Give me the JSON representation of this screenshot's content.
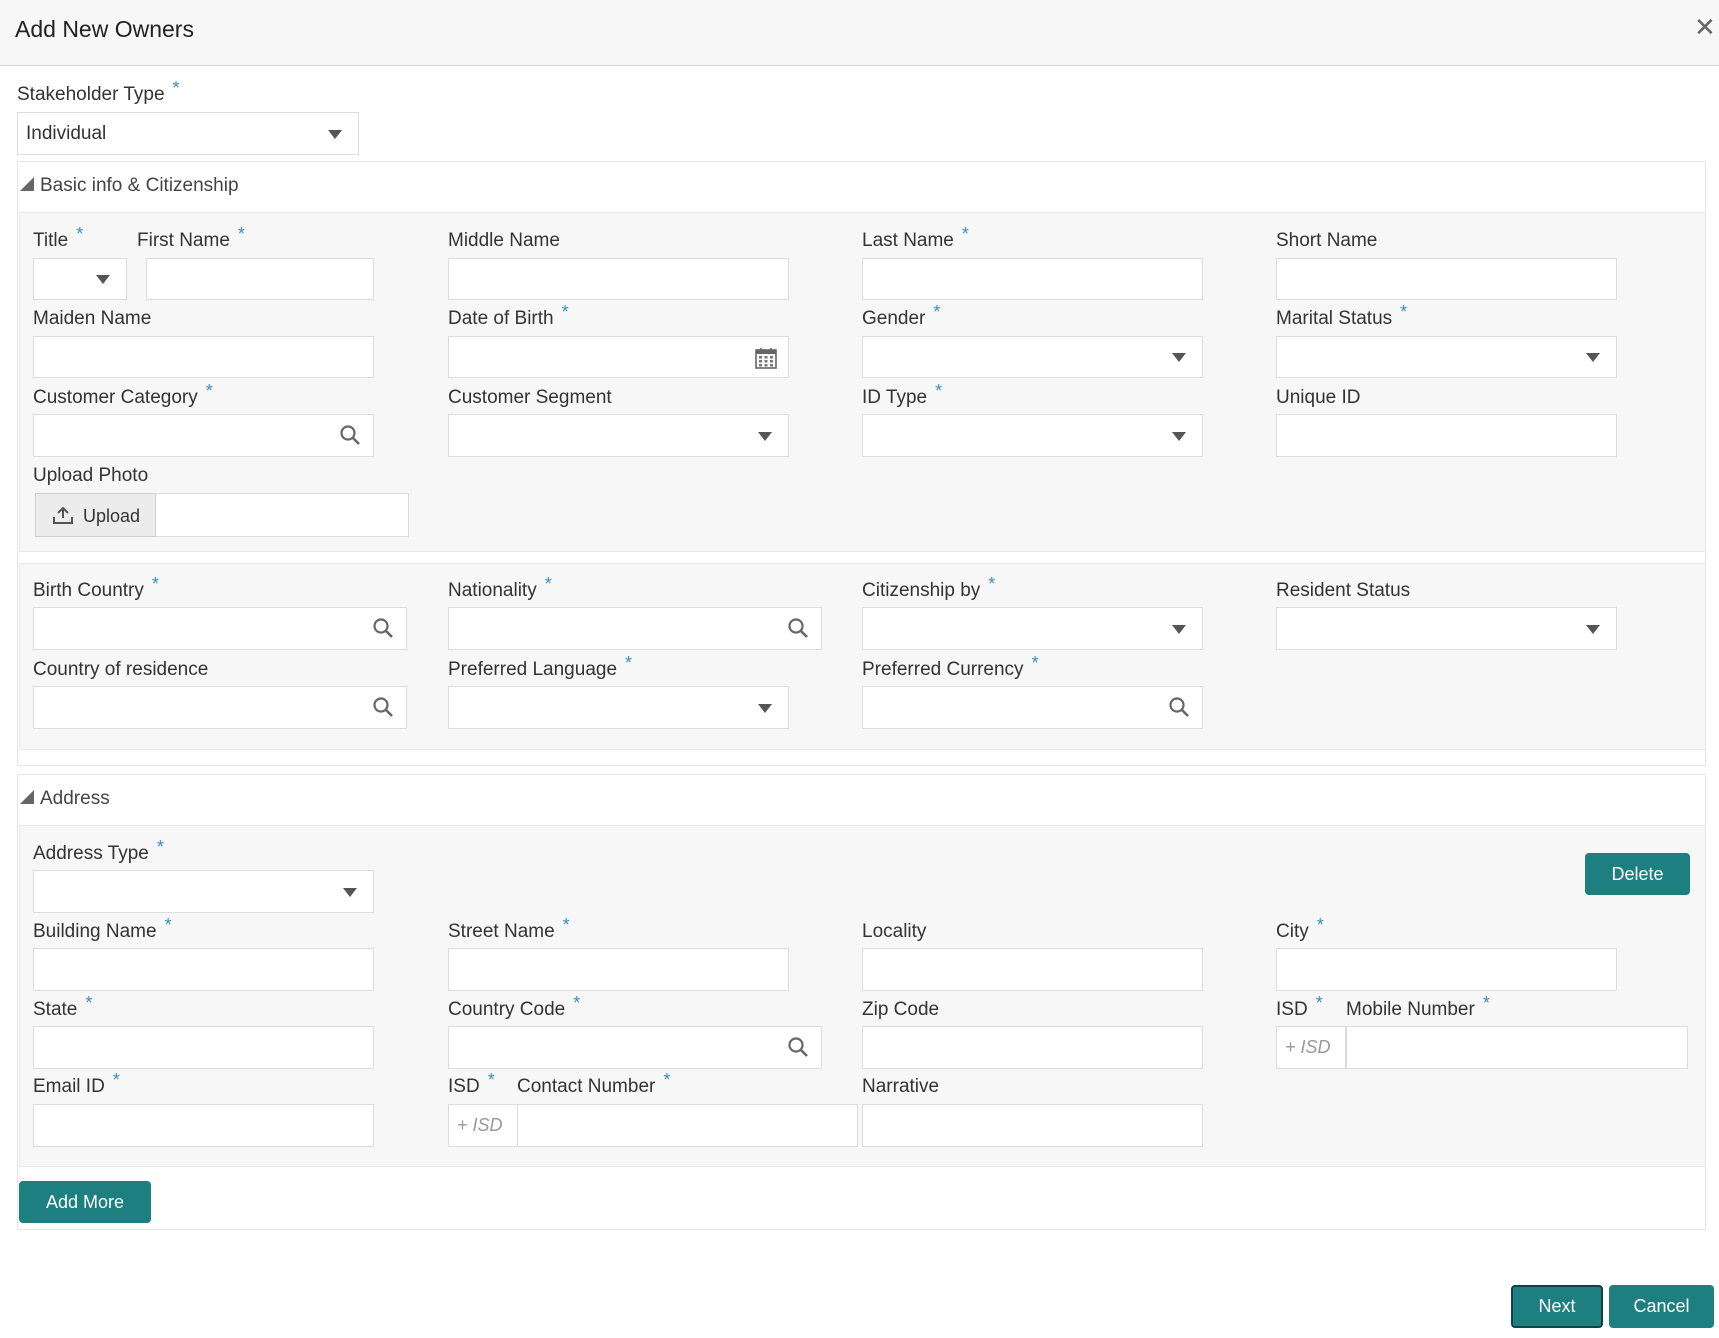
{
  "window": {
    "title": "Add New Owners",
    "close_icon": "close-icon"
  },
  "stakeholder": {
    "label": "Stakeholder Type",
    "value": "Individual"
  },
  "basic": {
    "section_title": "Basic info & Citizenship",
    "title_label": "Title",
    "first_name_label": "First Name",
    "middle_name_label": "Middle Name",
    "last_name_label": "Last Name",
    "short_name_label": "Short Name",
    "maiden_name_label": "Maiden Name",
    "dob_label": "Date of Birth",
    "gender_label": "Gender",
    "marital_label": "Marital Status",
    "customer_category_label": "Customer Category",
    "customer_segment_label": "Customer Segment",
    "id_type_label": "ID Type",
    "unique_id_label": "Unique ID",
    "upload_photo_label": "Upload Photo",
    "upload_button": "Upload"
  },
  "citizenship": {
    "birth_country_label": "Birth Country",
    "nationality_label": "Nationality",
    "citizenship_by_label": "Citizenship by",
    "resident_status_label": "Resident Status",
    "country_residence_label": "Country of residence",
    "preferred_language_label": "Preferred Language",
    "preferred_currency_label": "Preferred Currency"
  },
  "address": {
    "section_title": "Address",
    "address_type_label": "Address Type",
    "delete_button": "Delete",
    "building_label": "Building Name",
    "street_label": "Street Name",
    "locality_label": "Locality",
    "city_label": "City",
    "state_label": "State",
    "country_code_label": "Country Code",
    "zip_label": "Zip Code",
    "isd_label": "ISD",
    "mobile_label": "Mobile Number",
    "isd_placeholder": "+ ISD",
    "email_label": "Email ID",
    "contact_label": "Contact Number",
    "narrative_label": "Narrative",
    "add_more_button": "Add More"
  },
  "footer": {
    "next_button": "Next",
    "cancel_button": "Cancel"
  },
  "colors": {
    "accent": "#1d7f7f",
    "required": "#3a8fc1"
  }
}
